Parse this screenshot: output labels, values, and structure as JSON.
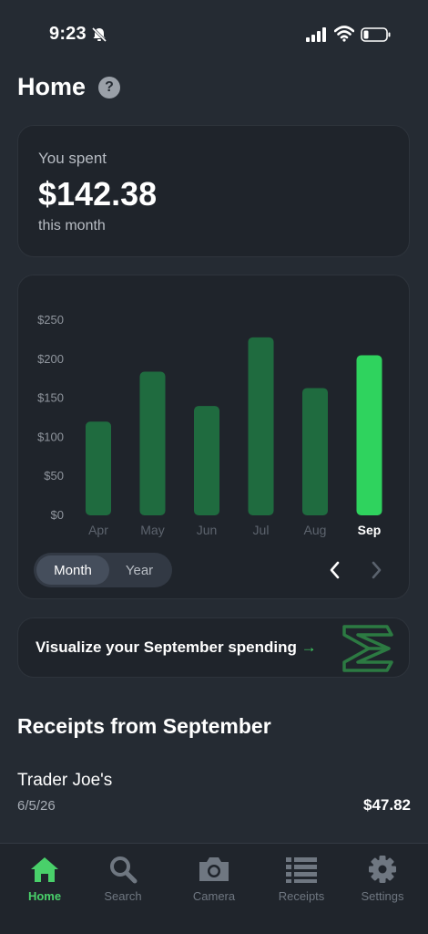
{
  "status_bar": {
    "time": "9:23"
  },
  "header": {
    "title": "Home",
    "help_symbol": "?"
  },
  "spent_card": {
    "label": "You spent",
    "amount": "$142.38",
    "period": "this month"
  },
  "chart_data": {
    "type": "bar",
    "categories": [
      "Apr",
      "May",
      "Jun",
      "Jul",
      "Aug",
      "Sep"
    ],
    "values": [
      120,
      184,
      140,
      228,
      163,
      205
    ],
    "selected_category": "Sep",
    "y_ticks": [
      "$0",
      "$50",
      "$100",
      "$150",
      "$200",
      "$250"
    ],
    "ylim": [
      0,
      250
    ],
    "grid": false,
    "colors": {
      "bar": "#1f6b3f",
      "selected_bar": "#2fd35e"
    }
  },
  "period_toggle": {
    "options": [
      "Month",
      "Year"
    ],
    "selected": "Month"
  },
  "visualize_card": {
    "text": "Visualize your September spending",
    "arrow": "→"
  },
  "receipts": {
    "title": "Receipts from September",
    "items": [
      {
        "name": "Trader Joe's",
        "date": "6/5/26",
        "amount": "$47.82"
      }
    ]
  },
  "tab_bar": {
    "items": [
      {
        "label": "Home",
        "icon": "home-icon",
        "active": true
      },
      {
        "label": "Search",
        "icon": "search-icon",
        "active": false
      },
      {
        "label": "Camera",
        "icon": "camera-icon",
        "active": false
      },
      {
        "label": "Receipts",
        "icon": "receipts-list-icon",
        "active": false
      },
      {
        "label": "Settings",
        "icon": "gear-icon",
        "active": false
      }
    ]
  },
  "colors": {
    "accent": "#49d06a",
    "background": "#252b33",
    "card": "#1f242b"
  }
}
